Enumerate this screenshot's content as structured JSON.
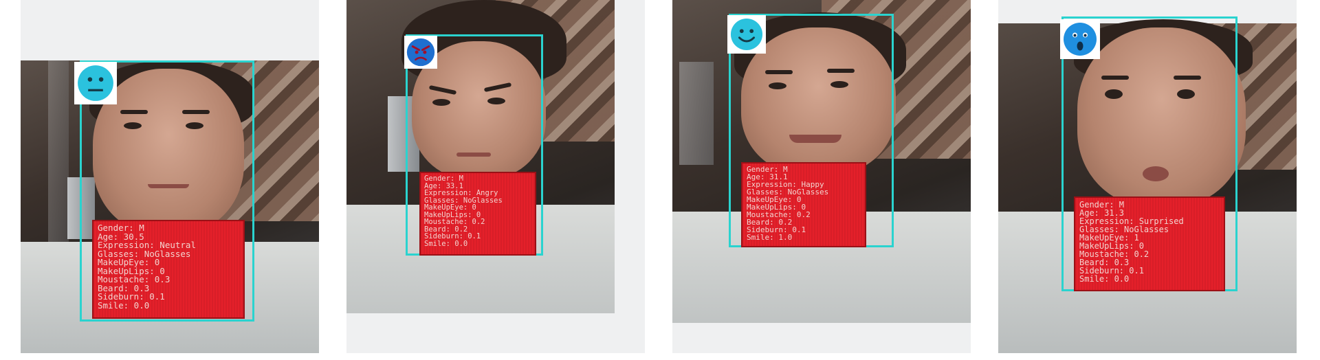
{
  "panels": [
    {
      "emoji": "neutral-face-icon",
      "emoji_color": "#2bc2de",
      "lines": [
        "Gender: M",
        "Age: 30.5",
        "Expression: Neutral",
        "Glasses: NoGlasses",
        "MakeUpEye: 0",
        "MakeUpLips: 0",
        "Moustache: 0.3",
        "Beard: 0.3",
        "Sideburn: 0.1",
        "Smile: 0.0"
      ]
    },
    {
      "emoji": "angry-face-icon",
      "emoji_color": "#1f6fcf",
      "lines": [
        "Gender: M",
        "Age: 33.1",
        "Expression: Angry",
        "Glasses: NoGlasses",
        "MakeUpEye: 0",
        "MakeUpLips: 0",
        "Moustache: 0.2",
        "Beard: 0.2",
        "Sideburn: 0.1",
        "Smile: 0.0"
      ]
    },
    {
      "emoji": "happy-face-icon",
      "emoji_color": "#2bc2de",
      "lines": [
        "Gender: M",
        "Age: 31.1",
        "Expression: Happy",
        "Glasses: NoGlasses",
        "MakeUpEye: 0",
        "MakeUpLips: 0",
        "Moustache: 0.2",
        "Beard: 0.2",
        "Sideburn: 0.1",
        "Smile: 1.0"
      ]
    },
    {
      "emoji": "surprised-face-icon",
      "emoji_color": "#1f8fe0",
      "lines": [
        "Gender: M",
        "Age: 31.3",
        "Expression: Surprised",
        "Glasses: NoGlasses",
        "MakeUpEye: 1",
        "MakeUpLips: 0",
        "Moustache: 0.2",
        "Beard: 0.3",
        "Sideburn: 0.1",
        "Smile: 0.0"
      ]
    }
  ],
  "colors": {
    "face_box": "#2ad3cf",
    "info_box": "#e4202a",
    "info_text": "#f3d3cf"
  }
}
